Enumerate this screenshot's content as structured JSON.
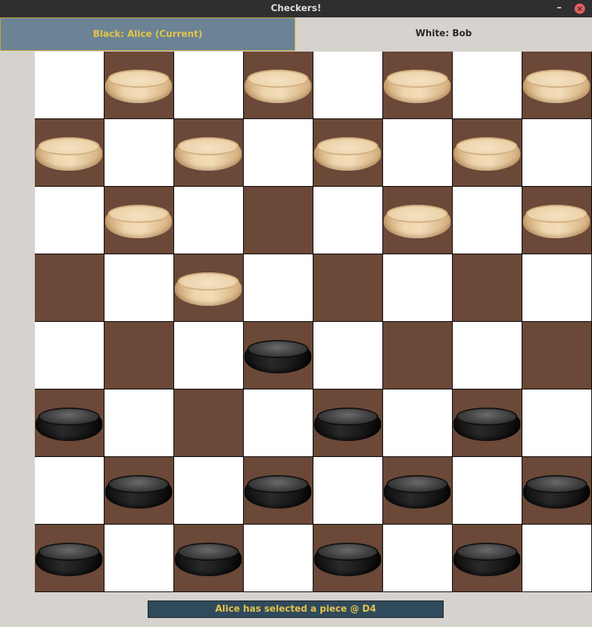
{
  "window": {
    "title": "Checkers!",
    "minimize_label": "–",
    "close_label": "×"
  },
  "players": {
    "black_label": "Black: Alice (Current)",
    "white_label": "White: Bob"
  },
  "colors": {
    "dark_square": "#6b4838",
    "light_square": "#ffffff",
    "active_tab": "#6b8394",
    "accent_text": "#e5c34a",
    "status_bg": "#2f4a5c"
  },
  "board": {
    "rows": [
      [
        "",
        "w",
        "",
        "w",
        "",
        "w",
        "",
        "w"
      ],
      [
        "w",
        "",
        "w",
        "",
        "w",
        "",
        "w",
        ""
      ],
      [
        "",
        "w",
        "",
        "",
        "",
        "w",
        "",
        "w"
      ],
      [
        "",
        "",
        "w",
        "",
        "",
        "",
        "",
        ""
      ],
      [
        "",
        "",
        "",
        "b",
        "",
        "",
        "",
        ""
      ],
      [
        "b",
        "",
        "",
        "",
        "b",
        "",
        "b",
        ""
      ],
      [
        "",
        "b",
        "",
        "b",
        "",
        "b",
        "",
        "b"
      ],
      [
        "b",
        "",
        "b",
        "",
        "b",
        "",
        "b",
        ""
      ]
    ]
  },
  "status": {
    "message": "Alice has selected a piece @ D4"
  }
}
